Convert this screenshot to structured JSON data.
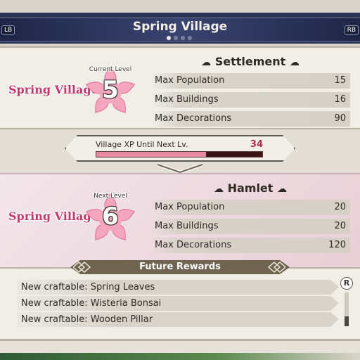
{
  "header": {
    "title": "Spring Village",
    "left_button": "LB",
    "right_button": "RB",
    "page_dots": 4,
    "active_dot": 0
  },
  "current": {
    "level_label": "Current Level",
    "level": "5",
    "village_name": "Spring Village",
    "rank": "Settlement",
    "stats": [
      {
        "label": "Max Population",
        "value": "15"
      },
      {
        "label": "Max Buildings",
        "value": "16"
      },
      {
        "label": "Max Decorations",
        "value": "90"
      }
    ]
  },
  "xp": {
    "label": "Village XP Until Next Lv.",
    "value": "34",
    "progress_fraction": 0.66
  },
  "next": {
    "level_label": "Next Level",
    "level": "6",
    "village_name": "Spring Village",
    "rank": "Hamlet",
    "stats": [
      {
        "label": "Max Population",
        "value": "20"
      },
      {
        "label": "Max Buildings",
        "value": "20"
      },
      {
        "label": "Max Decorations",
        "value": "120"
      }
    ]
  },
  "rewards": {
    "title": "Future Rewards",
    "items": [
      "New craftable: Spring Leaves",
      "New craftable: Wisteria Bonsai",
      "New craftable: Wooden Pillar"
    ],
    "scroll_button": "R"
  },
  "colors": {
    "header_band": "#2b3355",
    "village_name": "#c2386a",
    "sakura": "#f4a6bf",
    "xp_fill": "#e88aa4",
    "xp_track": "#3b1414"
  }
}
